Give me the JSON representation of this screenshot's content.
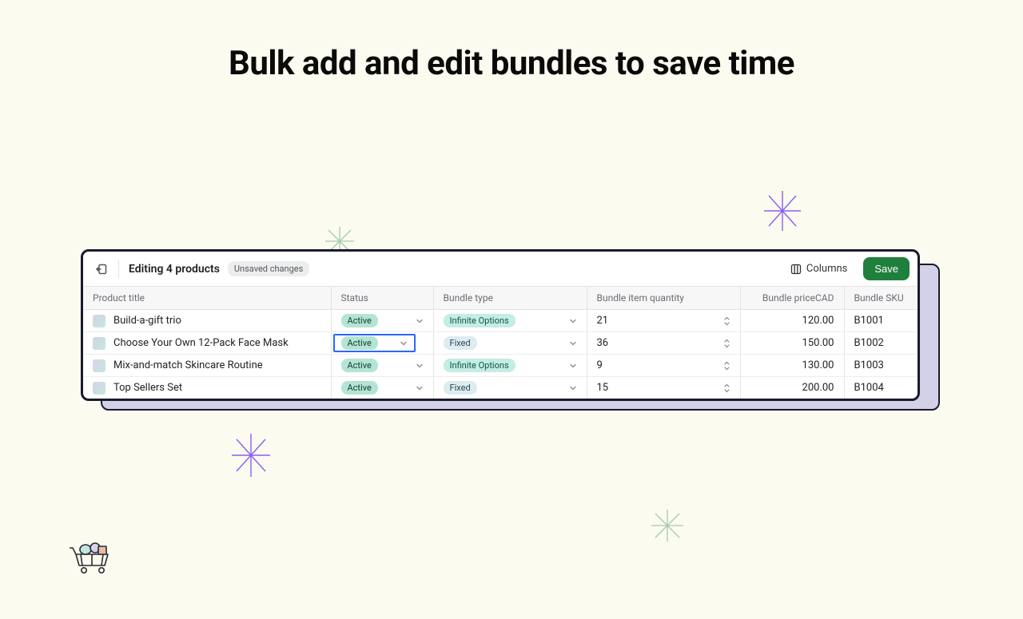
{
  "heading": "Bulk add and edit bundles to save time",
  "toolbar": {
    "editing_label": "Editing 4 products",
    "unsaved_label": "Unsaved changes",
    "columns_label": "Columns",
    "save_label": "Save"
  },
  "columns": {
    "title": "Product title",
    "status": "Status",
    "type": "Bundle type",
    "qty": "Bundle item quantity",
    "price": "Bundle price",
    "currency": "CAD",
    "sku": "Bundle SKU"
  },
  "rows": [
    {
      "title": "Build-a-gift trio",
      "status": "Active",
      "type": "Infinite Options",
      "type_kind": "infinite",
      "qty": "21",
      "price": "120.00",
      "sku": "B1001",
      "focused": false
    },
    {
      "title": "Choose Your Own 12-Pack Face Mask",
      "status": "Active",
      "type": "Fixed",
      "type_kind": "fixed",
      "qty": "36",
      "price": "150.00",
      "sku": "B1002",
      "focused": true
    },
    {
      "title": "Mix-and-match Skincare Routine",
      "status": "Active",
      "type": "Infinite Options",
      "type_kind": "infinite",
      "qty": "9",
      "price": "130.00",
      "sku": "B1003",
      "focused": false
    },
    {
      "title": "Top Sellers Set",
      "status": "Active",
      "type": "Fixed",
      "type_kind": "fixed",
      "qty": "15",
      "price": "200.00",
      "sku": "B1004",
      "focused": false
    }
  ]
}
